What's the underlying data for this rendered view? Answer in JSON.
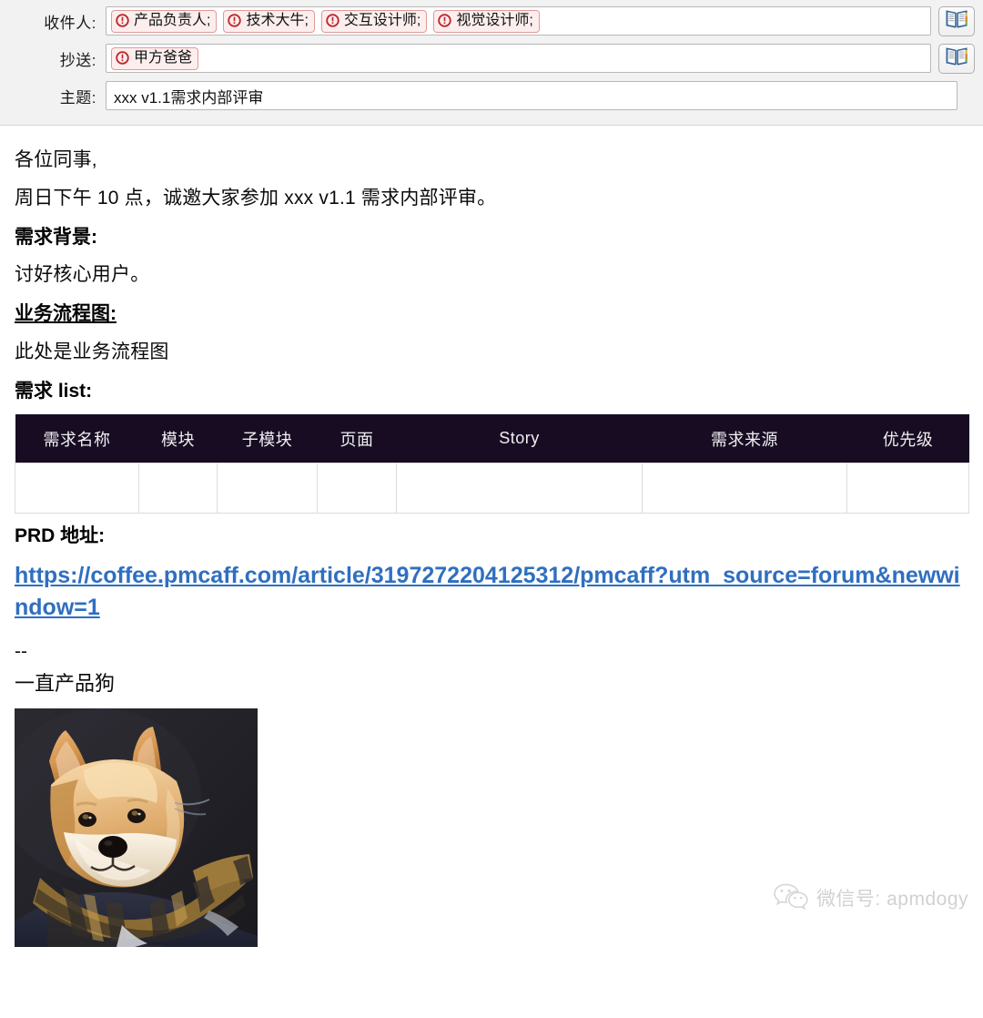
{
  "compose": {
    "to": {
      "label": "收件人:",
      "recipients": [
        {
          "name": "产品负责人;",
          "icon": "error-circle-icon"
        },
        {
          "name": "技术大牛;",
          "icon": "error-circle-icon"
        },
        {
          "name": "交互设计师;",
          "icon": "error-circle-icon"
        },
        {
          "name": "视觉设计师;",
          "icon": "error-circle-icon"
        }
      ],
      "address_book_icon": "address-book-icon"
    },
    "cc": {
      "label": "抄送:",
      "recipients": [
        {
          "name": "甲方爸爸",
          "icon": "error-circle-icon"
        }
      ],
      "address_book_icon": "address-book-icon"
    },
    "subject": {
      "label": "主题:",
      "value": "xxx v1.1需求内部评审"
    },
    "chip_border_color": "#e09a9a",
    "chip_background_color": "#fdeeee",
    "chip_icon_color": "#c0272d"
  },
  "body": {
    "greeting": "各位同事,",
    "intro": "周日下午 10 点，诚邀大家参加 xxx v1.1 需求内部评审。",
    "section_background_heading": "需求背景:",
    "section_background_text": "讨好核心用户。",
    "section_flowchart_heading": "业务流程图:",
    "section_flowchart_text": "此处是业务流程图",
    "section_list_heading": "需求 list:",
    "section_prd_heading": "PRD 地址:",
    "prd_url": "https://coffee.pmcaff.com/article/3197272204125312/pmcaff?utm_source=forum&newwindow=1",
    "signature_separator": "--",
    "signature_name": "一直产品狗",
    "link_color": "#2f6fc0"
  },
  "table": {
    "header_background_color": "#180c22",
    "headers": [
      "需求名称",
      "模块",
      "子模块",
      "页面",
      "Story",
      "需求来源",
      "优先级"
    ],
    "rows": [
      [
        "",
        "",
        "",
        "",
        "",
        "",
        ""
      ]
    ]
  },
  "watermark": {
    "icon": "wechat-icon",
    "text": "微信号: apmdogy",
    "color": "#c9c9c9"
  },
  "photo": {
    "alt": "一直产品狗 柴犬头像",
    "subject": "shiba-inu-dog-with-plaid-scarf"
  }
}
